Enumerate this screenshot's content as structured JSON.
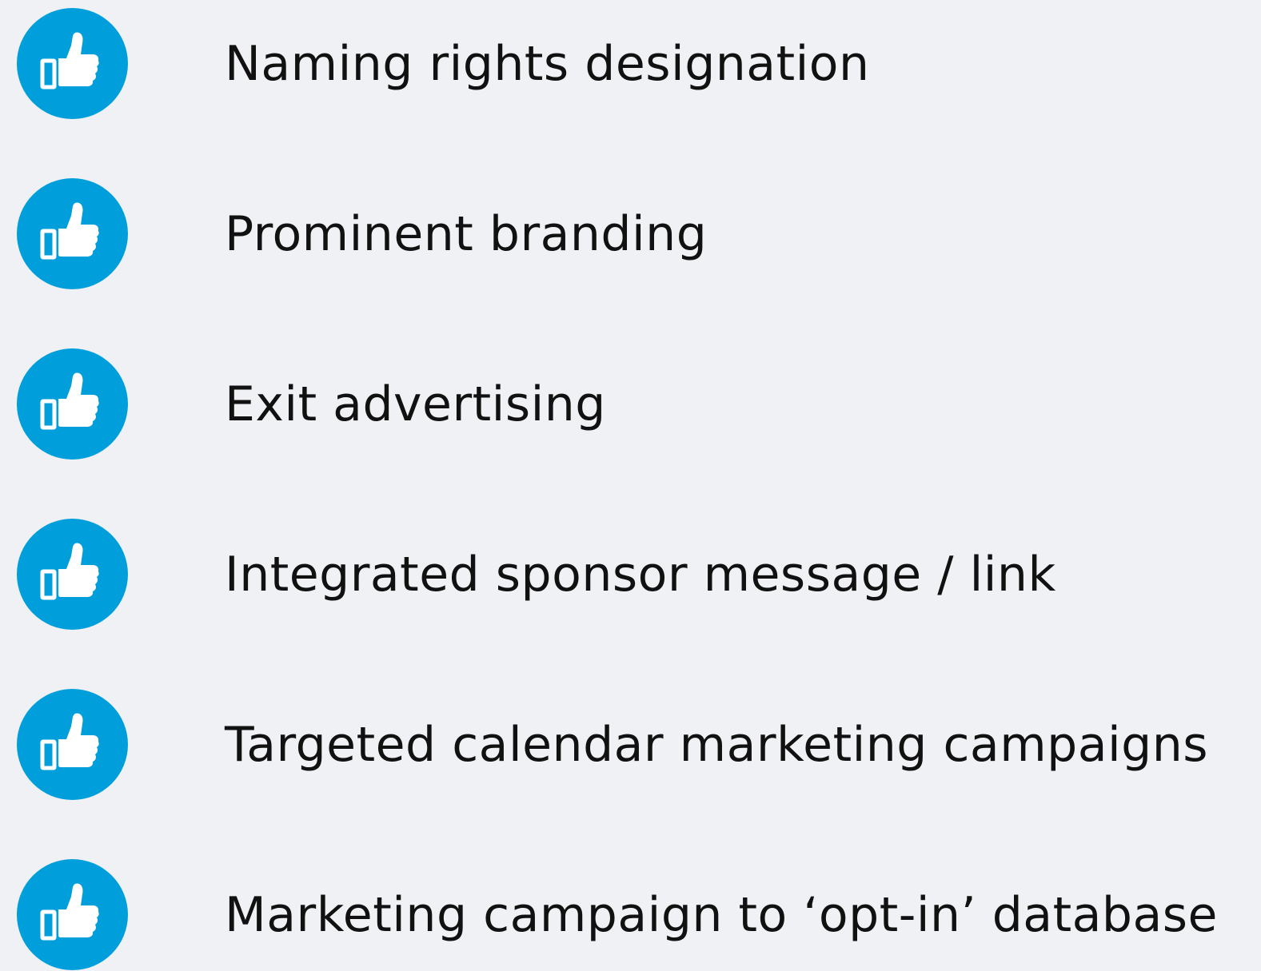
{
  "theme": {
    "background": "#eff1f5",
    "badge_color": "#009fdb",
    "icon_color": "#ffffff",
    "text_color": "#111111"
  },
  "benefits": [
    {
      "icon": "thumbs-up-icon",
      "label": "Naming rights designation"
    },
    {
      "icon": "thumbs-up-icon",
      "label": "Prominent branding"
    },
    {
      "icon": "thumbs-up-icon",
      "label": "Exit advertising"
    },
    {
      "icon": "thumbs-up-icon",
      "label": "Integrated sponsor message / link"
    },
    {
      "icon": "thumbs-up-icon",
      "label": "Targeted calendar marketing campaigns"
    },
    {
      "icon": "thumbs-up-icon",
      "label": "Marketing campaign to ‘opt-in’ database"
    }
  ]
}
